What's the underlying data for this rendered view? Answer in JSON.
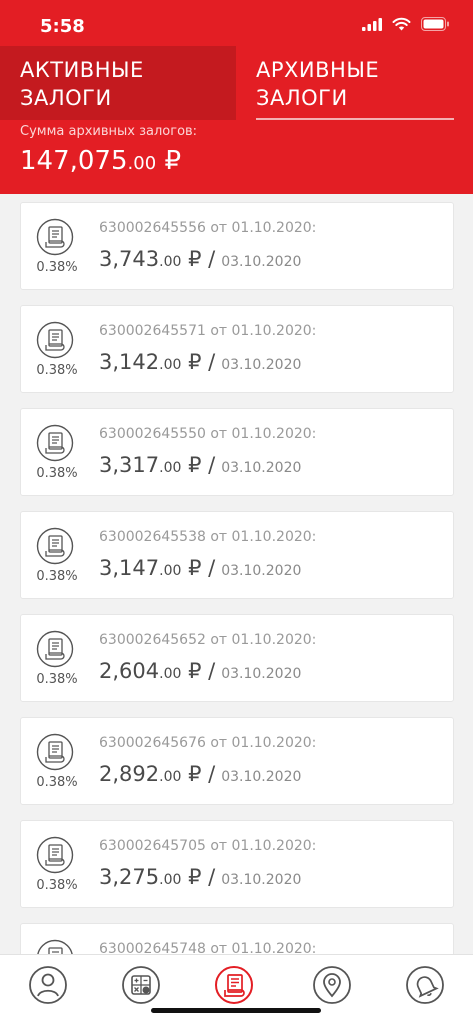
{
  "status_bar": {
    "time": "5:58"
  },
  "tabs": {
    "active_label": "АКТИВНЫЕ ЗАЛОГИ",
    "archived_label": "АРХИВНЫЕ ЗАЛОГИ"
  },
  "summary": {
    "label": "Сумма архивных залогов:",
    "value_int": "147,075",
    "value_cents": ".00",
    "currency": "₽"
  },
  "loans": [
    {
      "title": "630002645556 от 01.10.2020:",
      "rate": "0.38%",
      "amount_int": "3,743",
      "amount_cents": ".00",
      "currency": "₽",
      "date": "03.10.2020"
    },
    {
      "title": "630002645571 от 01.10.2020:",
      "rate": "0.38%",
      "amount_int": "3,142",
      "amount_cents": ".00",
      "currency": "₽",
      "date": "03.10.2020"
    },
    {
      "title": "630002645550 от 01.10.2020:",
      "rate": "0.38%",
      "amount_int": "3,317",
      "amount_cents": ".00",
      "currency": "₽",
      "date": "03.10.2020"
    },
    {
      "title": "630002645538 от 01.10.2020:",
      "rate": "0.38%",
      "amount_int": "3,147",
      "amount_cents": ".00",
      "currency": "₽",
      "date": "03.10.2020"
    },
    {
      "title": "630002645652 от 01.10.2020:",
      "rate": "0.38%",
      "amount_int": "2,604",
      "amount_cents": ".00",
      "currency": "₽",
      "date": "03.10.2020"
    },
    {
      "title": "630002645676 от 01.10.2020:",
      "rate": "0.38%",
      "amount_int": "2,892",
      "amount_cents": ".00",
      "currency": "₽",
      "date": "03.10.2020"
    },
    {
      "title": "630002645705 от 01.10.2020:",
      "rate": "0.38%",
      "amount_int": "3,275",
      "amount_cents": ".00",
      "currency": "₽",
      "date": "03.10.2020"
    },
    {
      "title": "630002645748 от 01.10.2020:",
      "rate": "",
      "amount_int": "",
      "amount_cents": "",
      "currency": "",
      "date": ""
    }
  ],
  "nav": {
    "items": [
      {
        "icon": "profile-icon"
      },
      {
        "icon": "calculator-icon"
      },
      {
        "icon": "loans-icon",
        "active": true
      },
      {
        "icon": "location-icon"
      },
      {
        "icon": "bell-icon"
      }
    ]
  },
  "colors": {
    "brand": "#e31e24",
    "brand_dark": "#c41a1f",
    "text": "#4a4a4a",
    "muted": "#9a9a9a"
  }
}
